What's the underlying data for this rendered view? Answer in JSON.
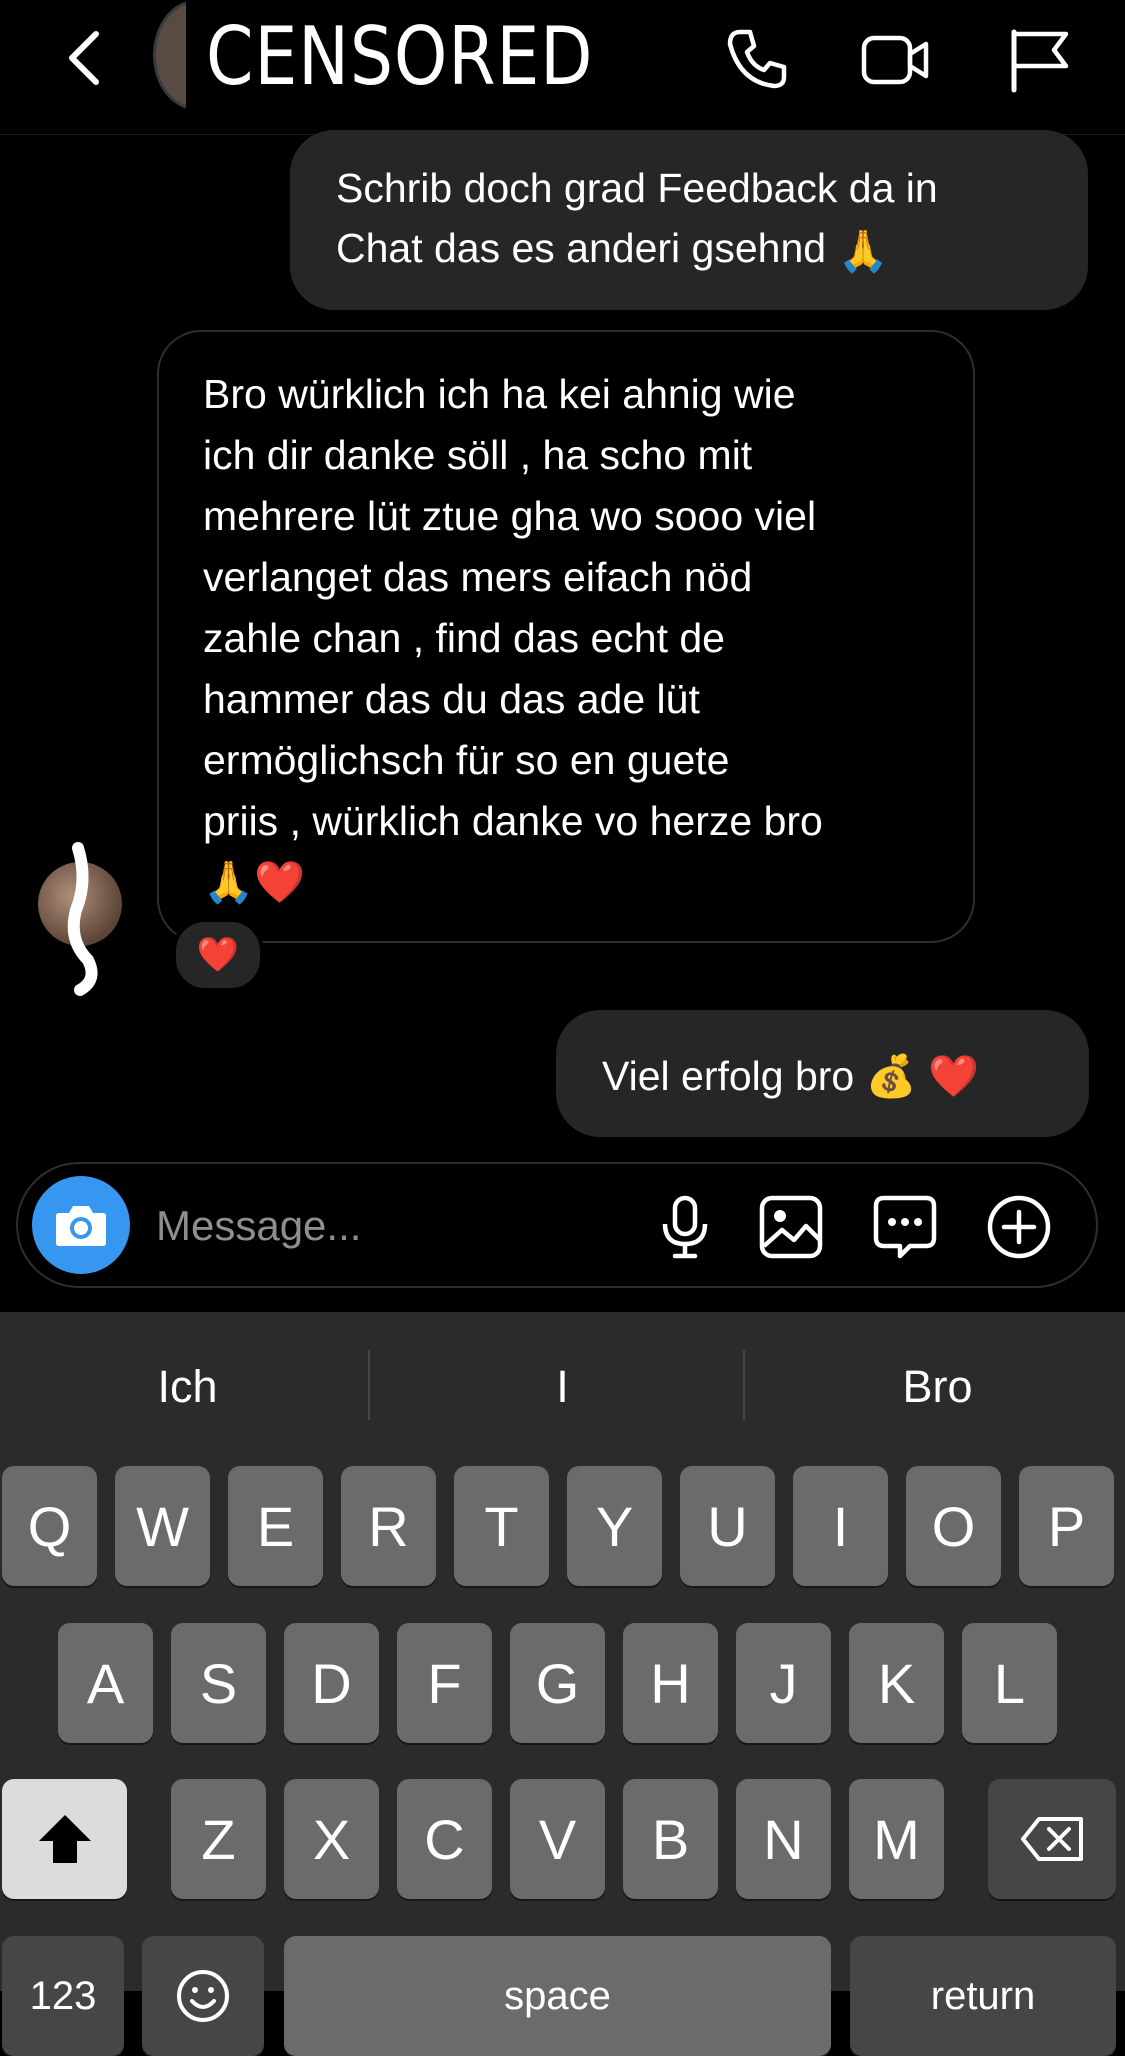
{
  "header": {
    "censored_label": "CENSORED",
    "icons": [
      "back-icon",
      "phone-icon",
      "video-icon",
      "flag-icon"
    ]
  },
  "messages": {
    "sent_1": {
      "line1": "Schrib doch grad Feedback da in",
      "line2": "Chat das es anderi gsehnd",
      "emoji": "🙏"
    },
    "received_1": {
      "lines": [
        "Bro würklich ich ha kei ahnig wie",
        "ich dir danke söll , ha scho mit",
        "mehrere lüt ztue gha wo sooo viel",
        "verlanget das mers eifach nöd",
        "zahle chan , find das echt de",
        "hammer das du das ade lüt",
        "ermöglichsch für so en guete",
        "priis , würklich danke vo herze bro"
      ],
      "emojis": "🙏❤️",
      "reaction": "❤️"
    },
    "sent_2": {
      "text": "Viel erfolg bro",
      "emojis": "💰 ❤️"
    }
  },
  "composer": {
    "placeholder": "Message...",
    "icons": [
      "camera-icon",
      "microphone-icon",
      "gallery-icon",
      "sticker-icon",
      "plus-icon"
    ]
  },
  "keyboard": {
    "suggestions": [
      "Ich",
      "I",
      "Bro"
    ],
    "row1": [
      "Q",
      "W",
      "E",
      "R",
      "T",
      "Y",
      "U",
      "I",
      "O",
      "P"
    ],
    "row2": [
      "A",
      "S",
      "D",
      "F",
      "G",
      "H",
      "J",
      "K",
      "L"
    ],
    "row3": [
      "Z",
      "X",
      "C",
      "V",
      "B",
      "N",
      "M"
    ],
    "bottom": {
      "numbers": "123",
      "space": "space",
      "return": "return"
    }
  },
  "colors": {
    "background": "#000000",
    "sent_bubble": "#262626",
    "accent_blue": "#3797f0",
    "keyboard_bg": "#2b2b2b",
    "key_bg": "#6b6b6b"
  }
}
